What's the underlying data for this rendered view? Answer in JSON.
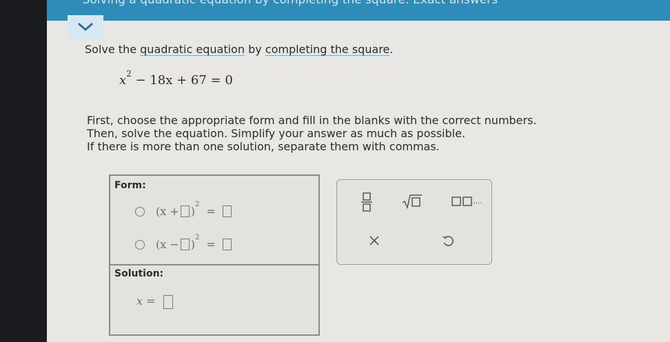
{
  "header": {
    "title": "Solving a quadratic equation by completing the square: Exact answers"
  },
  "question": {
    "prefix": "Solve the ",
    "link1": "quadratic equation",
    "mid": " by ",
    "link2": "completing the square",
    "suffix": ".",
    "equation": {
      "base": "x",
      "exp": "2",
      "rest": " − 18x + 67 = 0"
    }
  },
  "instructions": [
    "First, choose the appropriate form and fill in the blanks with the correct numbers.",
    "Then, solve the equation. Simplify your answer as much as possible.",
    "If there is more than one solution, separate them with commas."
  ],
  "answer": {
    "form_label": "Form:",
    "option1": {
      "open": "(x + ",
      "close": ")",
      "exp": "2",
      "eq": "="
    },
    "option2": {
      "open": "(x − ",
      "close": ")",
      "exp": "2",
      "eq": "="
    },
    "solution_label": "Solution:",
    "solution_var": "x =",
    "selected_option": null
  },
  "keypad": {
    "buttons": [
      "fraction-button",
      "square-root-button",
      "list-button",
      "clear-button",
      "undo-button"
    ],
    "list_suffix": ",..."
  }
}
